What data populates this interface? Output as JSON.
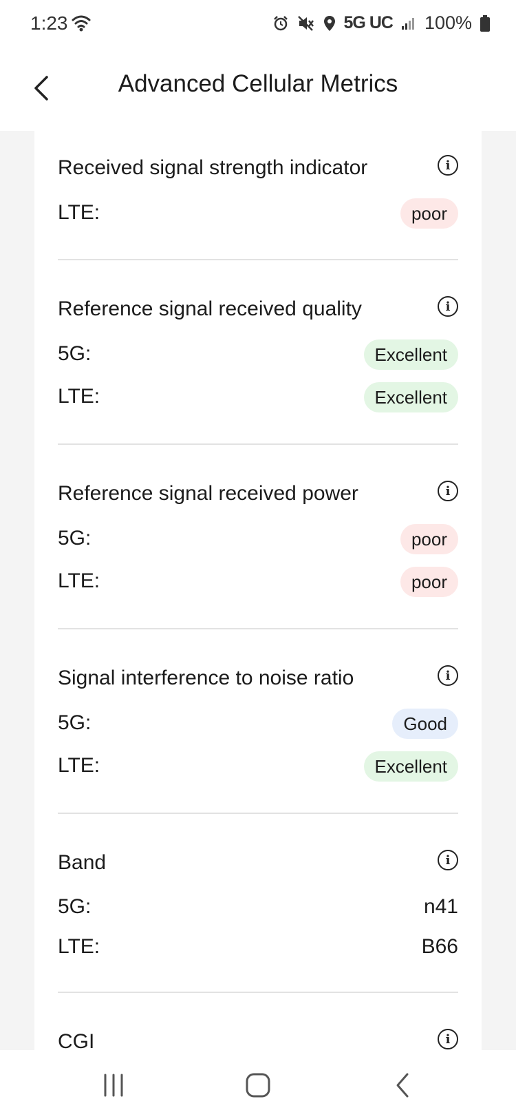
{
  "status_bar": {
    "time": "1:23",
    "network": "5G UC",
    "battery": "100%",
    "icons": [
      "wifi-icon",
      "alarm-icon",
      "mute-icon",
      "location-icon",
      "signal-icon",
      "battery-icon"
    ]
  },
  "header": {
    "title": "Advanced Cellular Metrics",
    "back_icon": "back-arrow-icon"
  },
  "sections": [
    {
      "title": "Received signal strength indicator",
      "rows": [
        {
          "label": "LTE:",
          "badge": "poor",
          "badge_color": "#fde8e7"
        }
      ]
    },
    {
      "title": "Reference signal received quality",
      "rows": [
        {
          "label": "5G:",
          "badge": "Excellent",
          "badge_color": "#e3f6e4"
        },
        {
          "label": "LTE:",
          "badge": "Excellent",
          "badge_color": "#e3f6e4"
        }
      ]
    },
    {
      "title": "Reference signal received power",
      "rows": [
        {
          "label": "5G:",
          "badge": "poor",
          "badge_color": "#fde8e7"
        },
        {
          "label": "LTE:",
          "badge": "poor",
          "badge_color": "#fde8e7"
        }
      ]
    },
    {
      "title": "Signal interference to noise ratio",
      "rows": [
        {
          "label": "5G:",
          "badge": "Good",
          "badge_color": "#e6eefb"
        },
        {
          "label": "LTE:",
          "badge": "Excellent",
          "badge_color": "#e3f6e4"
        }
      ]
    },
    {
      "title": "Band",
      "rows": [
        {
          "label": "5G:",
          "value": "n41"
        },
        {
          "label": "LTE:",
          "value": "B66"
        }
      ]
    },
    {
      "title": "CGI",
      "rows": []
    }
  ],
  "nav_bar": {
    "icons": [
      "recent-apps-icon",
      "home-icon",
      "back-icon"
    ]
  }
}
